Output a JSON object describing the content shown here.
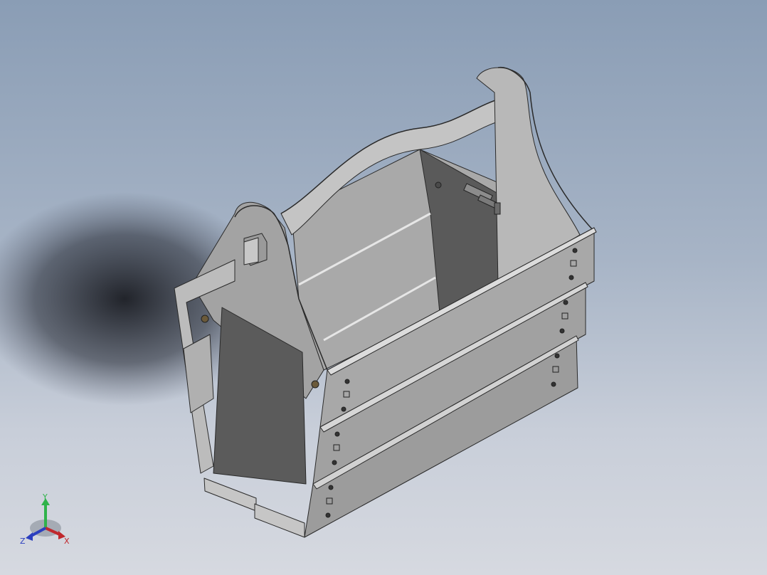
{
  "viewport": {
    "background_top": "#8a9db5",
    "background_bottom": "#d6d9e0"
  },
  "model": {
    "face_light": "#bfbfbf",
    "face_mid": "#a6a6a6",
    "face_dark": "#595959",
    "edge": "#2a2a2a"
  },
  "triad": {
    "x_label": "X",
    "y_label": "Y",
    "z_label": "Z",
    "x_color": "#c0282d",
    "y_color": "#2fb34a",
    "z_color": "#2b3fbf"
  }
}
